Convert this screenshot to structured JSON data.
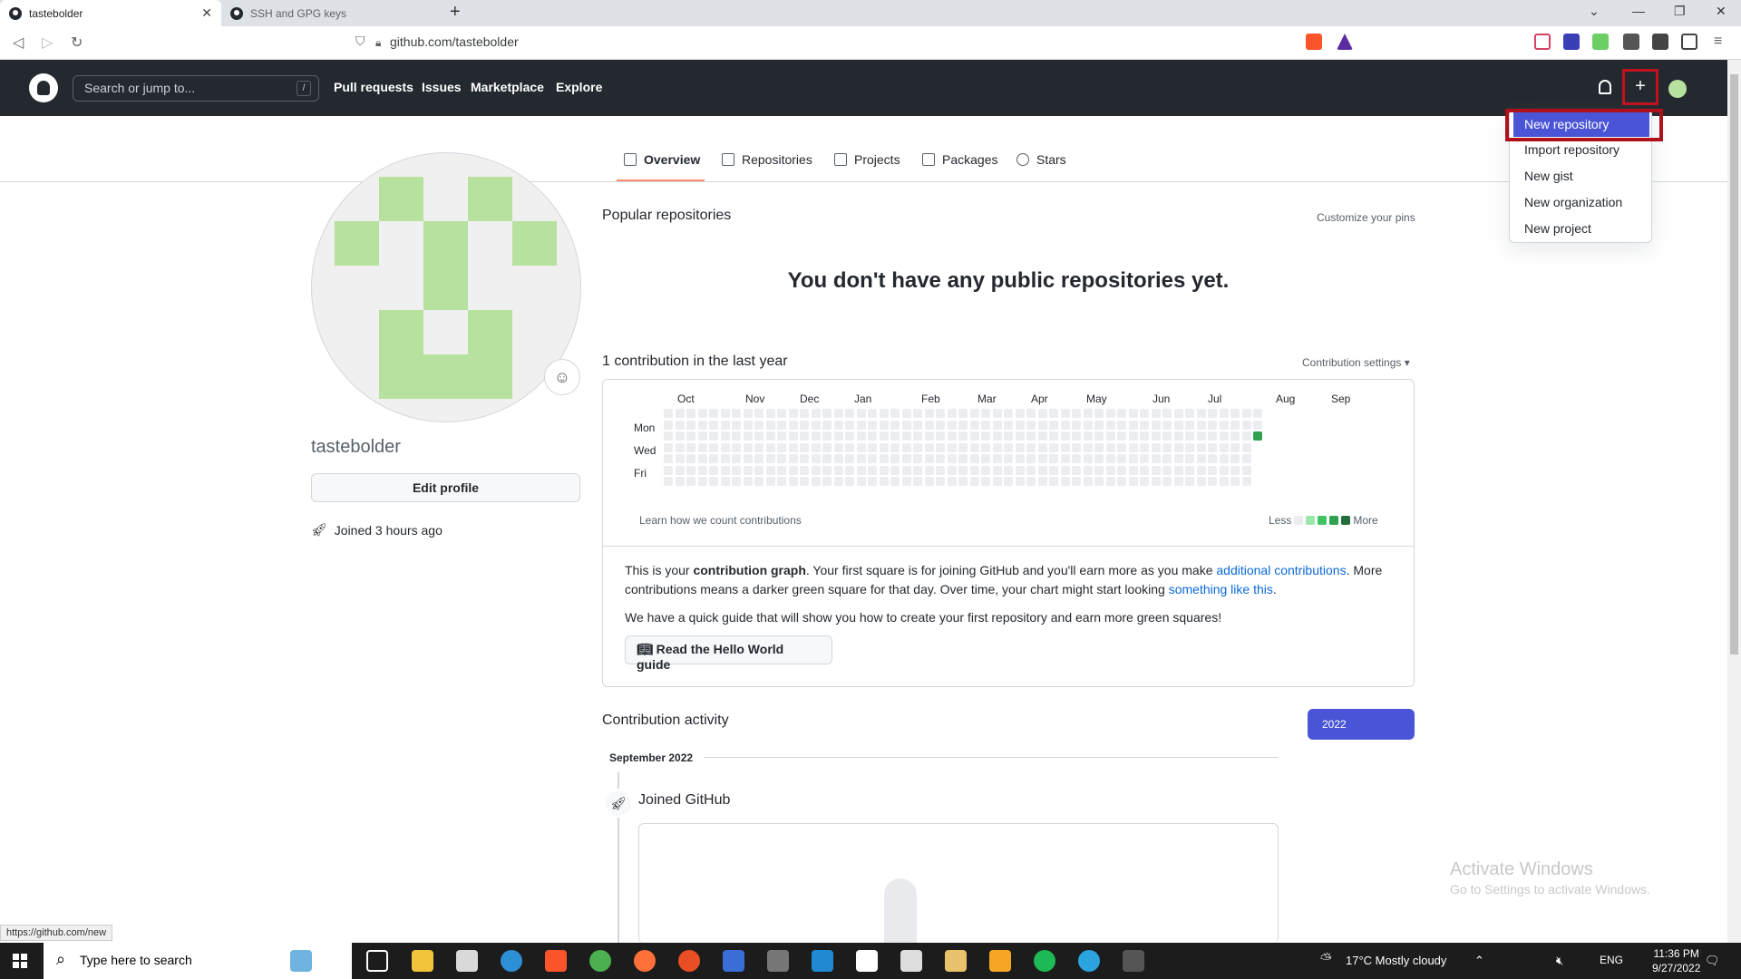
{
  "browser": {
    "tabs": [
      {
        "title": "tastebolder",
        "active": true
      },
      {
        "title": "SSH and GPG keys",
        "active": false
      }
    ],
    "url": "github.com/tastebolder",
    "status_url": "https://github.com/new"
  },
  "header": {
    "search_placeholder": "Search or jump to...",
    "search_shortcut": "/",
    "nav": [
      "Pull requests",
      "Issues",
      "Marketplace",
      "Explore"
    ]
  },
  "dropdown": {
    "items": [
      "New repository",
      "Import repository",
      "New gist",
      "New organization",
      "New project"
    ]
  },
  "profile_nav": {
    "items": [
      "Overview",
      "Repositories",
      "Projects",
      "Packages",
      "Stars"
    ]
  },
  "profile": {
    "username": "tastebolder",
    "edit_button": "Edit profile",
    "joined": "Joined 3 hours ago",
    "emoji_icon": "☺"
  },
  "main": {
    "popular_heading": "Popular repositories",
    "customize_pins": "Customize your pins",
    "no_repos": "You don't have any public repositories yet.",
    "contrib_count": "1 contribution in the last year",
    "contrib_settings": "Contribution settings ▾",
    "months": [
      "Oct",
      "Nov",
      "Dec",
      "Jan",
      "Feb",
      "Mar",
      "Apr",
      "May",
      "Jun",
      "Jul",
      "Aug",
      "Sep"
    ],
    "day_labels": [
      "Mon",
      "Wed",
      "Fri"
    ],
    "learn_link": "Learn how we count contributions",
    "legend_less": "Less",
    "legend_more": "More",
    "legend_colors": [
      "#ebedf0",
      "#9be9a8",
      "#40c463",
      "#30a14e",
      "#216e39"
    ],
    "graph_text": {
      "p1_a": "This is your ",
      "p1_b": "contribution graph",
      "p1_c": ". Your first square is for joining GitHub and you'll earn more as you make ",
      "p1_link1": "additional contributions",
      "p1_d": ". More contributions means a darker green square for that day. Over time, your chart might start looking ",
      "p1_link2": "something like this",
      "p1_e": ".",
      "p2": "We have a quick guide that will show you how to create your first repository and earn more green squares!",
      "guide_button": "Read the Hello World guide"
    },
    "activity_heading": "Contribution activity",
    "year_button": "2022",
    "month_label": "September 2022",
    "joined_github": "Joined GitHub"
  },
  "watermark": {
    "line1": "Activate Windows",
    "line2": "Go to Settings to activate Windows."
  },
  "taskbar": {
    "search_placeholder": "Type here to search",
    "weather": "17°C  Mostly cloudy",
    "lang": "ENG",
    "time": "11:36 PM",
    "date": "9/27/2022"
  }
}
